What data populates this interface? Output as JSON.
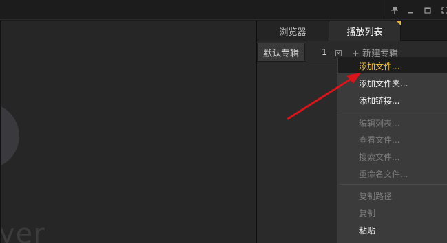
{
  "window": {
    "controls": {
      "pin_icon": "pin-icon",
      "minimize_icon": "minimize-icon",
      "maximize_icon": "maximize-icon",
      "fullscreen_icon": "fullscreen-icon"
    }
  },
  "player": {
    "logo_text": "yer"
  },
  "tabs": [
    {
      "label": "浏览器",
      "active": false
    },
    {
      "label": "播放列表",
      "active": true
    }
  ],
  "albums": {
    "default_label": "默认专辑",
    "count": "1",
    "close_glyph": "×",
    "new_album_label": "+ 新建专辑"
  },
  "context_menu": {
    "items": [
      {
        "label": "添加文件...",
        "state": "highlight"
      },
      {
        "label": "添加文件夹...",
        "state": "enabled"
      },
      {
        "label": "添加链接...",
        "state": "enabled"
      },
      {
        "label": "编辑列表...",
        "state": "disabled"
      },
      {
        "label": "查看文件...",
        "state": "disabled"
      },
      {
        "label": "搜索文件...",
        "state": "disabled"
      },
      {
        "label": "重命名文件...",
        "state": "disabled"
      },
      {
        "label": "复制路径",
        "state": "disabled"
      },
      {
        "label": "复制",
        "state": "disabled"
      },
      {
        "label": "粘贴",
        "state": "enabled"
      }
    ]
  },
  "colors": {
    "accent": "#f2c43a",
    "arrow": "#d9141a"
  }
}
